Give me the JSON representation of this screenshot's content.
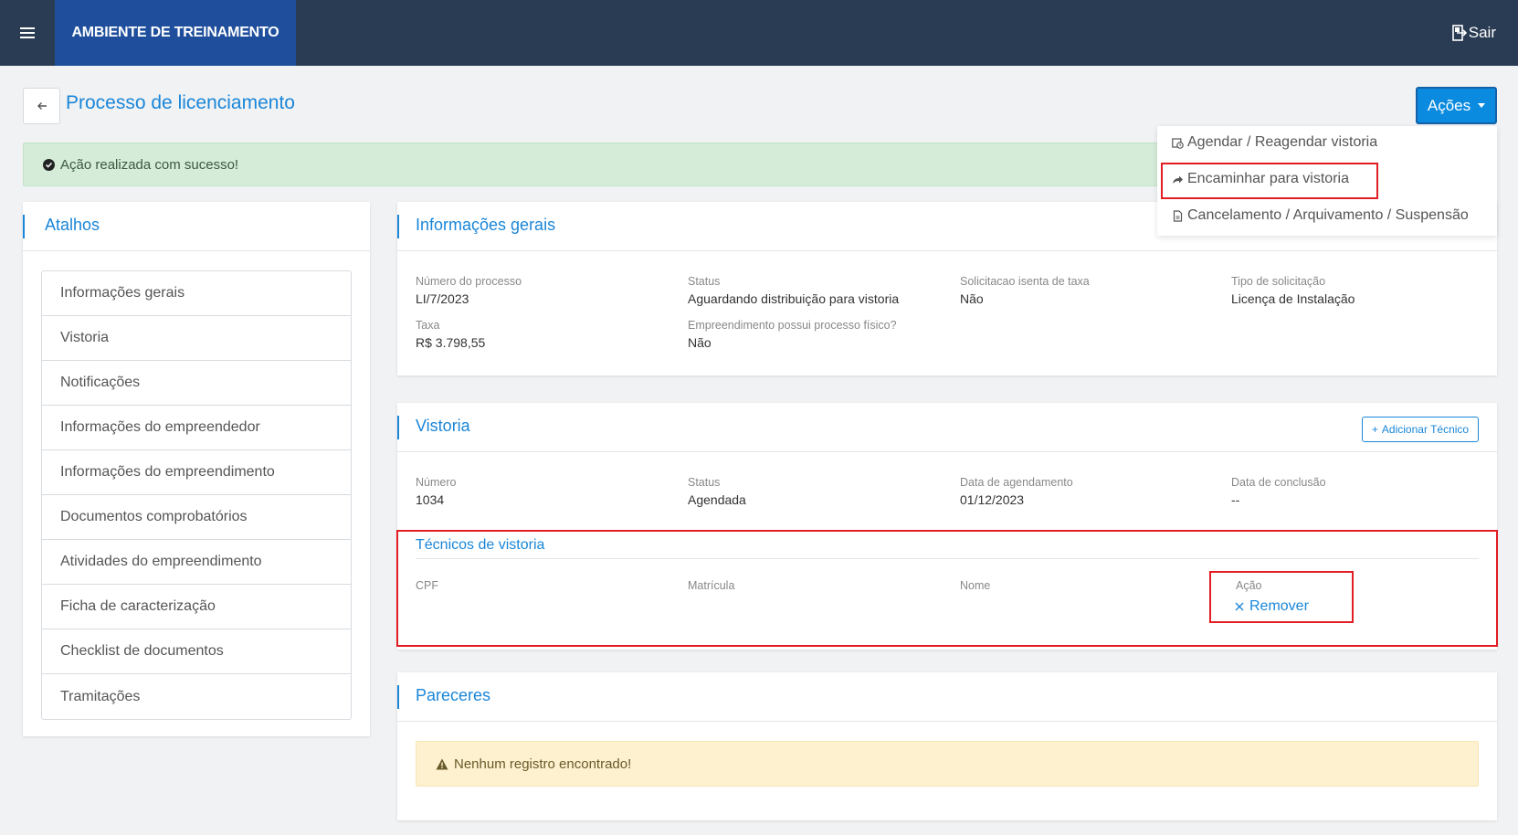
{
  "topbar": {
    "env_label": "AMBIENTE DE TREINAMENTO",
    "logout_label": "Sair"
  },
  "header": {
    "title": "Processo de licenciamento",
    "actions_label": "Ações"
  },
  "alert": {
    "success_message": "Ação realizada com sucesso!"
  },
  "actions_menu": {
    "items": [
      {
        "label": "Agendar / Reagendar vistoria",
        "icon": "calendar-clock-icon"
      },
      {
        "label": "Encaminhar para vistoria",
        "icon": "share-arrow-icon"
      },
      {
        "label": "Cancelamento / Arquivamento / Suspensão",
        "icon": "document-icon"
      }
    ]
  },
  "shortcuts": {
    "title": "Atalhos",
    "items": [
      "Informações gerais",
      "Vistoria",
      "Notificações",
      "Informações do empreendedor",
      "Informações do empreendimento",
      "Documentos comprobatórios",
      "Atividades do empreendimento",
      "Ficha de caracterização",
      "Checklist de documentos",
      "Tramitações"
    ]
  },
  "general_info": {
    "title": "Informações gerais",
    "process_number_label": "Número do processo",
    "process_number": "LI/7/2023",
    "status_label": "Status",
    "status": "Aguardando distribuição para vistoria",
    "fee_exempt_label": "Solicitacao isenta de taxa",
    "fee_exempt": "Não",
    "request_type_label": "Tipo de solicitação",
    "request_type": "Licença de Instalação",
    "fee_label": "Taxa",
    "fee": "R$ 3.798,55",
    "physical_process_label": "Empreendimento possui processo físico?",
    "physical_process": "Não"
  },
  "vistoria": {
    "title": "Vistoria",
    "add_tech_label": "Adicionar Técnico",
    "number_label": "Número",
    "number": "1034",
    "status_label": "Status",
    "status": "Agendada",
    "schedule_date_label": "Data de agendamento",
    "schedule_date": "01/12/2023",
    "conclusion_date_label": "Data de conclusão",
    "conclusion_date": "--",
    "technicians_title": "Técnicos de vistoria",
    "col_cpf": "CPF",
    "col_registration": "Matrícula",
    "col_name": "Nome",
    "col_action": "Ação",
    "remove_label": "Remover"
  },
  "pareceres": {
    "title": "Pareceres",
    "empty_message": "Nenhum registro encontrado!"
  },
  "colors": {
    "topbar": "#2a3c53",
    "env_badge": "#1f4f9c",
    "primary": "#1a86d8",
    "highlight": "#e21d23"
  }
}
